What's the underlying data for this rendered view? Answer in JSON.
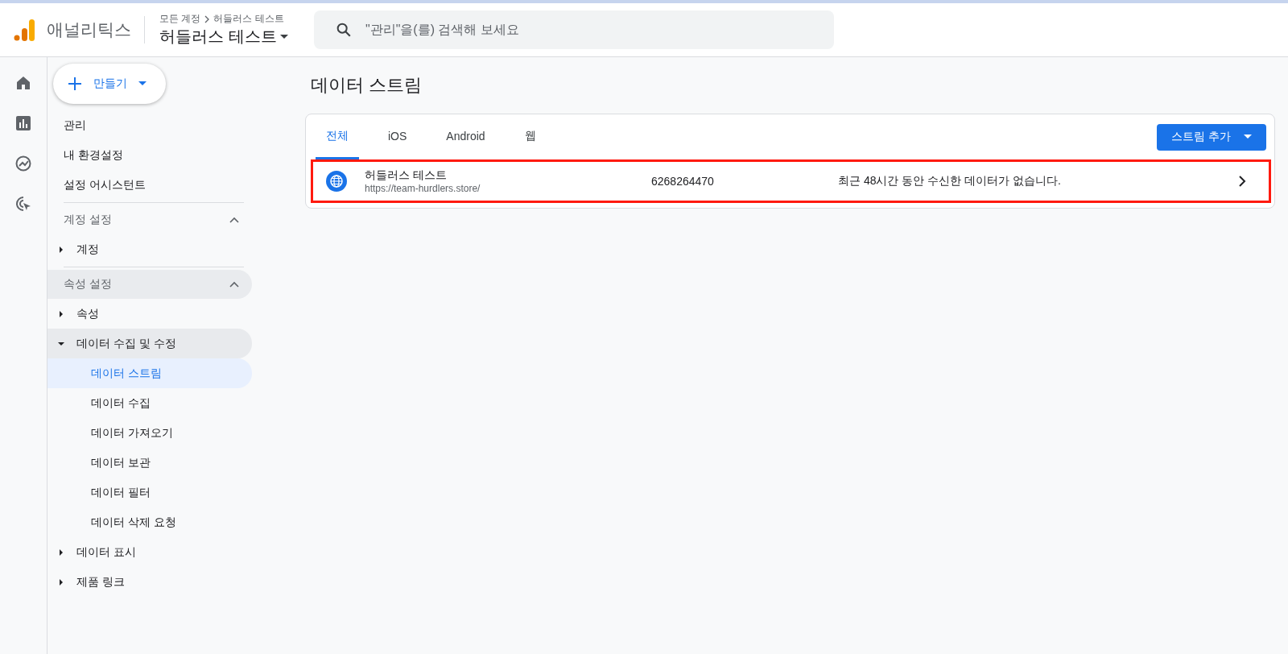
{
  "header": {
    "product": "애널리틱스",
    "breadcrumb": [
      "모든 계정",
      "허들러스 테스트"
    ],
    "property": "허들러스 테스트",
    "search": {
      "placeholder": "\"관리\"을(를) 검색해 보세요"
    }
  },
  "rail": [
    {
      "kind": "home",
      "selected": false
    },
    {
      "kind": "reports",
      "selected": false
    },
    {
      "kind": "explore",
      "selected": false
    },
    {
      "kind": "advertising",
      "selected": false
    }
  ],
  "create_button": "만들기",
  "sidebar": {
    "top_items": [
      "관리",
      "내 환경설정",
      "설정 어시스턴트"
    ],
    "sections": [
      {
        "title": "계정 설정",
        "expanded": true,
        "highlighted": false,
        "items": [
          {
            "label": "계정",
            "expanded": false,
            "highlighted": false
          }
        ]
      },
      {
        "title": "속성 설정",
        "expanded": true,
        "highlighted": true,
        "items": [
          {
            "label": "속성",
            "expanded": false,
            "highlighted": false
          },
          {
            "label": "데이터 수집 및 수정",
            "expanded": true,
            "highlighted": true,
            "children": [
              {
                "label": "데이터 스트림",
                "selected": true
              },
              {
                "label": "데이터 수집",
                "selected": false
              },
              {
                "label": "데이터 가져오기",
                "selected": false
              },
              {
                "label": "데이터 보관",
                "selected": false
              },
              {
                "label": "데이터 필터",
                "selected": false
              },
              {
                "label": "데이터 삭제 요청",
                "selected": false
              }
            ]
          },
          {
            "label": "데이터 표시",
            "expanded": false,
            "highlighted": false
          },
          {
            "label": "제품 링크",
            "expanded": false,
            "highlighted": false
          }
        ]
      }
    ]
  },
  "page_title": "데이터 스트림",
  "tabs": [
    {
      "label": "전체",
      "selected": true
    },
    {
      "label": "iOS",
      "selected": false
    },
    {
      "label": "Android",
      "selected": false
    },
    {
      "label": "웹",
      "selected": false
    }
  ],
  "add_stream_button": "스트림 추가",
  "streams": [
    {
      "name": "허들러스 테스트",
      "url": "https://team-hurdlers.store/",
      "id": "6268264470",
      "status": "최근 48시간 동안 수신한 데이터가 없습니다.",
      "highlighted": true
    }
  ]
}
